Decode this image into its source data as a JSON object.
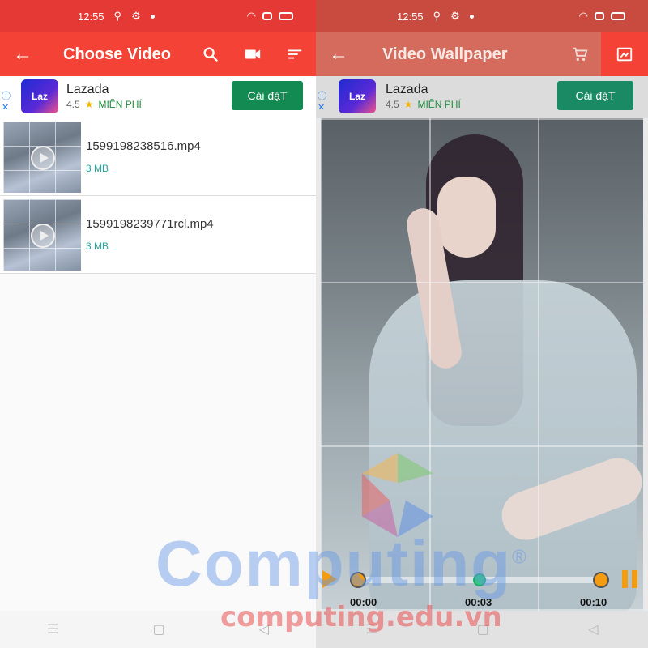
{
  "status_bar": {
    "time": "12:55"
  },
  "left_screen": {
    "app_bar": {
      "title": "Choose Video",
      "back_icon": "arrow-back-icon",
      "actions": [
        "search-icon",
        "videocam-icon",
        "sort-icon"
      ]
    },
    "ad": {
      "name": "Lazada",
      "logo_text": "Laz",
      "rating": "4.5",
      "price": "MIỄN PHÍ",
      "install_label": "Cài đặT"
    },
    "videos": [
      {
        "filename": "1599198238516.mp4",
        "size": "3 MB"
      },
      {
        "filename": "1599198239771rcl.mp4",
        "size": "3 MB"
      }
    ]
  },
  "right_screen": {
    "app_bar": {
      "title": "Video Wallpaper",
      "back_icon": "arrow-back-icon",
      "actions": [
        "cart-icon",
        "set-wallpaper-icon"
      ]
    },
    "ad": {
      "name": "Lazada",
      "logo_text": "Laz",
      "rating": "4.5",
      "price": "MIỄN PHÍ",
      "install_label": "Cài đặT"
    },
    "player": {
      "current_time": "00:00",
      "mid_time": "00:03",
      "end_time": "00:10",
      "progress_fraction": 0.0
    }
  },
  "watermark": {
    "brand": "Computing",
    "url": "computing.edu.vn",
    "registered_mark": "®"
  },
  "colors": {
    "primary": "#f44336",
    "status_bar": "#e53935",
    "install_button": "#138a52",
    "accent_teal": "#26a69a",
    "player_accent": "#f39c12"
  }
}
